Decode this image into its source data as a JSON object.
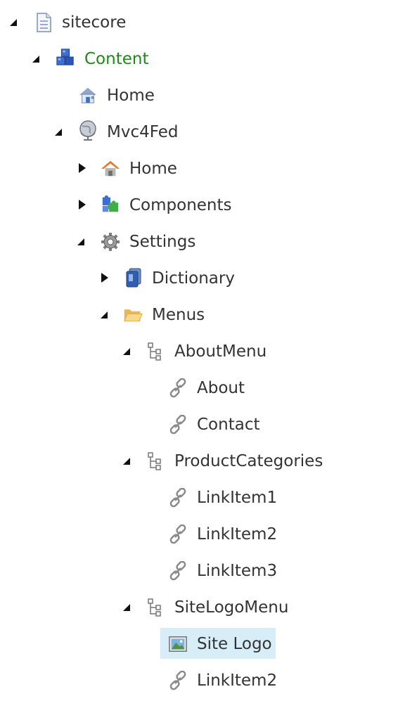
{
  "tree": {
    "nodes": [
      {
        "label": "sitecore",
        "icon": "page-icon",
        "state": "expanded"
      },
      {
        "label": "Content",
        "icon": "content-cubes-icon",
        "state": "expanded",
        "color": "#1b8a1b"
      },
      {
        "label": "Home",
        "icon": "home-house-icon",
        "state": "leaf"
      },
      {
        "label": "Mvc4Fed",
        "icon": "globe-icon",
        "state": "expanded"
      },
      {
        "label": "Home",
        "icon": "home-roof-icon",
        "state": "collapsed"
      },
      {
        "label": "Components",
        "icon": "puzzle-icon",
        "state": "collapsed"
      },
      {
        "label": "Settings",
        "icon": "gear-icon",
        "state": "expanded"
      },
      {
        "label": "Dictionary",
        "icon": "book-icon",
        "state": "collapsed"
      },
      {
        "label": "Menus",
        "icon": "folder-icon",
        "state": "expanded"
      },
      {
        "label": "AboutMenu",
        "icon": "menu-tree-icon",
        "state": "expanded"
      },
      {
        "label": "About",
        "icon": "link-icon",
        "state": "leaf"
      },
      {
        "label": "Contact",
        "icon": "link-icon",
        "state": "leaf"
      },
      {
        "label": "ProductCategories",
        "icon": "menu-tree-icon",
        "state": "expanded"
      },
      {
        "label": "LinkItem1",
        "icon": "link-icon",
        "state": "leaf"
      },
      {
        "label": "LinkItem2",
        "icon": "link-icon",
        "state": "leaf"
      },
      {
        "label": "LinkItem3",
        "icon": "link-icon",
        "state": "leaf"
      },
      {
        "label": "SiteLogoMenu",
        "icon": "menu-tree-icon",
        "state": "expanded"
      },
      {
        "label": "Site Logo",
        "icon": "image-icon",
        "state": "leaf",
        "selected": true
      },
      {
        "label": "LinkItem2",
        "icon": "link-icon",
        "state": "leaf"
      }
    ]
  },
  "colors": {
    "selection": "#d7eef8",
    "content_label": "#1b8a1b",
    "text": "#333333"
  }
}
